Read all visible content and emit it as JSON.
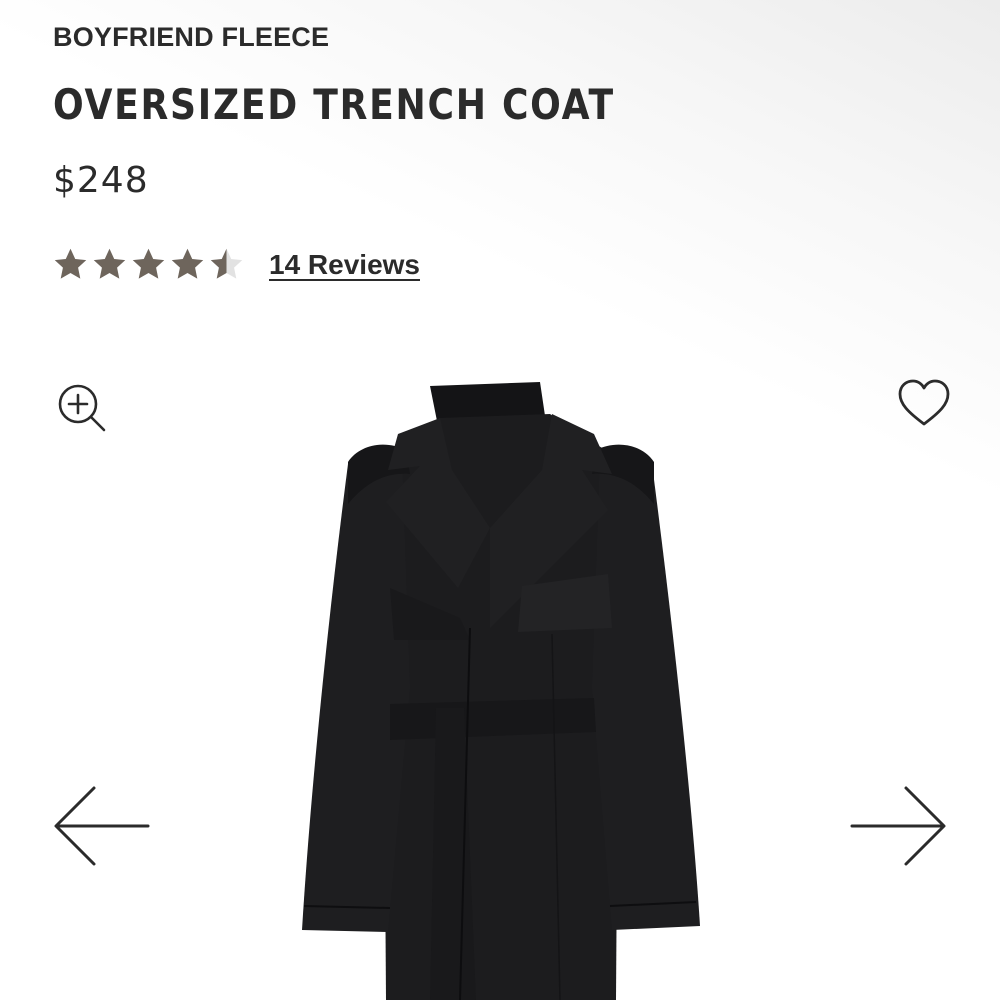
{
  "product": {
    "collection": "BOYFRIEND FLEECE",
    "title": "OVERSIZED TRENCH COAT",
    "price": "$248",
    "rating": 4.5,
    "rating_max": 5,
    "reviews_label": "14 Reviews",
    "image_alt": "Black oversized trench coat with belt"
  },
  "colors": {
    "star_filled": "#6e655c",
    "star_empty": "#e2e2e2",
    "text": "#2b2b2b",
    "coat": "#1c1c1e"
  },
  "icons": {
    "zoom": "zoom-in-icon",
    "wishlist": "heart-icon",
    "prev": "arrow-left-icon",
    "next": "arrow-right-icon",
    "star": "star-icon"
  }
}
